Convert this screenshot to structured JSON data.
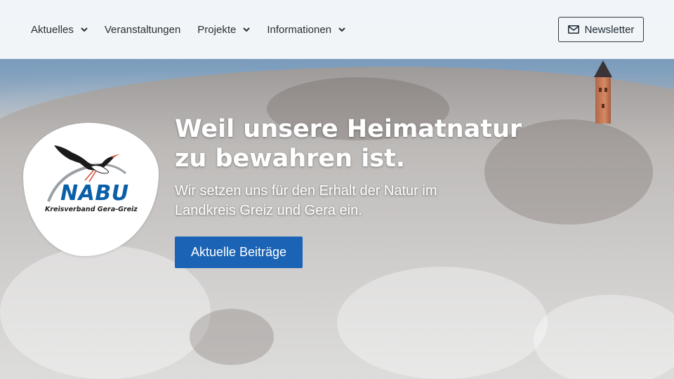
{
  "nav": {
    "items": [
      {
        "label": "Aktuelles",
        "has_dropdown": true
      },
      {
        "label": "Veranstaltungen",
        "has_dropdown": false
      },
      {
        "label": "Projekte",
        "has_dropdown": true
      },
      {
        "label": "Informationen",
        "has_dropdown": true
      }
    ],
    "newsletter_label": "Newsletter",
    "newsletter_icon": "envelope-icon"
  },
  "logo": {
    "brand": "NABU",
    "subtitle": "Kreisverband Gera-Greiz",
    "icon": "stork-icon"
  },
  "hero": {
    "headline_line1": "Weil unsere Heimatnatur",
    "headline_line2": "zu bewahren ist.",
    "subline_line1": "Wir setzen uns für den Erhalt der Natur im",
    "subline_line2": "Landkreis Greiz und Gera ein.",
    "cta_label": "Aktuelle Beiträge"
  },
  "colors": {
    "accent": "#1a63b5",
    "brand_blue": "#0b5fa8",
    "navbar_bg": "#f6f8fa"
  }
}
